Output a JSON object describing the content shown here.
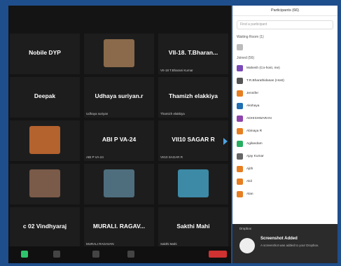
{
  "meeting": {
    "top_status": "",
    "tiles": [
      {
        "name": "Nobile DYP",
        "sub": "",
        "video": false
      },
      {
        "name": "",
        "sub": "",
        "video": true,
        "thumb_color": "#8a6a4a"
      },
      {
        "name": "VII-18. T.Bharan...",
        "sub": "VII-18 T.Bharani Kumar",
        "video": false
      },
      {
        "name": "Deepak",
        "sub": "",
        "video": false
      },
      {
        "name": "Udhaya suriyan.r",
        "sub": "Udhaya suriyan",
        "video": false
      },
      {
        "name": "Thamizh elakkiya",
        "sub": "Thamizh elakkiya",
        "video": false
      },
      {
        "name": "",
        "sub": "",
        "video": true,
        "thumb_color": "#b4622e"
      },
      {
        "name": "ABI P VA-24",
        "sub": "ABI P VA-24",
        "video": false
      },
      {
        "name": "VII10 SAGAR R",
        "sub": "VII10 SAGAR R",
        "video": false
      },
      {
        "name": "",
        "sub": "",
        "video": true,
        "thumb_color": "#7a5a48"
      },
      {
        "name": "",
        "sub": "",
        "video": true,
        "thumb_color": "#4e6e7e"
      },
      {
        "name": "",
        "sub": "",
        "video": true,
        "thumb_color": "#3c8aa6"
      },
      {
        "name": "c 02 Vindhyaraj",
        "sub": "",
        "video": false
      },
      {
        "name": "MURALI. RAGAV...",
        "sub": "MURALI RAGAVAN",
        "video": false
      },
      {
        "name": "Sakthi Mahi",
        "sub": "Sakthi Mahi",
        "video": false
      }
    ]
  },
  "panel": {
    "title": "Participants (66)",
    "search_placeholder": "Find a participant",
    "waiting_label": "Waiting Room (1)",
    "inmeeting_label": "Joined (56)",
    "participants": [
      {
        "name": "Mahesh (Co-host, me)",
        "color": "#7a4ab8"
      },
      {
        "name": "T.R.Bharathidasan (Host)",
        "color": "#555555"
      },
      {
        "name": "Jennifer",
        "color": "#e67e22"
      },
      {
        "name": "Akshaya",
        "color": "#1f6fb2"
      },
      {
        "name": "ADHISHWARAN",
        "color": "#8e44ad"
      },
      {
        "name": "Abinaya R",
        "color": "#e67e22"
      },
      {
        "name": "Agilandam",
        "color": "#27ae60"
      },
      {
        "name": "Ajay Kumar",
        "color": "#666666"
      },
      {
        "name": "Ajith",
        "color": "#e67e22"
      },
      {
        "name": "Akil",
        "color": "#e67e22"
      },
      {
        "name": "Alan",
        "color": "#e67e22"
      }
    ],
    "toast": {
      "label": "Dropbox",
      "title": "Screenshot Added",
      "sub": "A screenshot was added to your Dropbox."
    }
  }
}
